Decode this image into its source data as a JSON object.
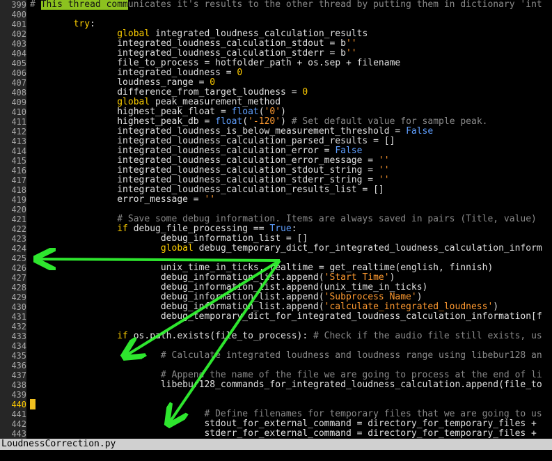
{
  "statusbar": {
    "filename": "LoudnessCorrection.py"
  },
  "cursor_line": 440,
  "lines": [
    {
      "n": "399",
      "s": [
        [
          "hl",
          "This thread comm"
        ],
        [
          "cm",
          "unicates it's results to the other thread by putting them in dictionary 'int"
        ]
      ],
      "p": "# "
    },
    {
      "n": "400",
      "s": []
    },
    {
      "n": "401",
      "s": [
        [
          "kw",
          "try"
        ],
        [
          "t",
          ":"
        ]
      ],
      "p": "        "
    },
    {
      "n": "402",
      "s": [
        [
          "kw",
          "global"
        ],
        [
          "t",
          " integrated_loudness_calculation_results"
        ]
      ],
      "p": "                "
    },
    {
      "n": "403",
      "s": [
        [
          "t",
          "integrated_loudness_calculation_stdout = b"
        ],
        [
          "st",
          "''"
        ]
      ],
      "p": "                "
    },
    {
      "n": "404",
      "s": [
        [
          "t",
          "integrated_loudness_calculation_stderr = b"
        ],
        [
          "st",
          "''"
        ]
      ],
      "p": "                "
    },
    {
      "n": "405",
      "s": [
        [
          "t",
          "file_to_process = hotfolder_path + os.sep + filename"
        ]
      ],
      "p": "                "
    },
    {
      "n": "406",
      "s": [
        [
          "t",
          "integrated_loudness = "
        ],
        [
          "num",
          "0"
        ]
      ],
      "p": "                "
    },
    {
      "n": "407",
      "s": [
        [
          "t",
          "loudness_range = "
        ],
        [
          "num",
          "0"
        ]
      ],
      "p": "                "
    },
    {
      "n": "408",
      "s": [
        [
          "t",
          "difference_from_target_loudness = "
        ],
        [
          "num",
          "0"
        ]
      ],
      "p": "                "
    },
    {
      "n": "409",
      "s": [
        [
          "kw",
          "global"
        ],
        [
          "t",
          " peak_measurement_method"
        ]
      ],
      "p": "                "
    },
    {
      "n": "410",
      "s": [
        [
          "t",
          "highest_peak_float = "
        ],
        [
          "bi",
          "float"
        ],
        [
          "t",
          "("
        ],
        [
          "st",
          "'0'"
        ],
        [
          "t",
          ")"
        ]
      ],
      "p": "                "
    },
    {
      "n": "411",
      "s": [
        [
          "t",
          "highest_peak_db = "
        ],
        [
          "bi",
          "float"
        ],
        [
          "t",
          "("
        ],
        [
          "st",
          "'-120'"
        ],
        [
          "t",
          ") "
        ],
        [
          "cm",
          "# Set default value for sample peak."
        ]
      ],
      "p": "                "
    },
    {
      "n": "412",
      "s": [
        [
          "t",
          "integrated_loudness_is_below_measurement_threshold = "
        ],
        [
          "bi",
          "False"
        ]
      ],
      "p": "                "
    },
    {
      "n": "413",
      "s": [
        [
          "t",
          "integrated_loudness_calculation_parsed_results = []"
        ]
      ],
      "p": "                "
    },
    {
      "n": "414",
      "s": [
        [
          "t",
          "integrated_loudness_calculation_error = "
        ],
        [
          "bi",
          "False"
        ]
      ],
      "p": "                "
    },
    {
      "n": "415",
      "s": [
        [
          "t",
          "integrated_loudness_calculation_error_message = "
        ],
        [
          "st",
          "''"
        ]
      ],
      "p": "                "
    },
    {
      "n": "416",
      "s": [
        [
          "t",
          "integrated_loudness_calculation_stdout_string = "
        ],
        [
          "st",
          "''"
        ]
      ],
      "p": "                "
    },
    {
      "n": "417",
      "s": [
        [
          "t",
          "integrated_loudness_calculation_stderr_string = "
        ],
        [
          "st",
          "''"
        ]
      ],
      "p": "                "
    },
    {
      "n": "418",
      "s": [
        [
          "t",
          "integrated_loudness_calculation_results_list = []"
        ]
      ],
      "p": "                "
    },
    {
      "n": "419",
      "s": [
        [
          "t",
          "error_message = "
        ],
        [
          "st",
          "''"
        ]
      ],
      "p": "                "
    },
    {
      "n": "420",
      "s": []
    },
    {
      "n": "421",
      "s": [
        [
          "cm",
          "# Save some debug information. Items are always saved in pairs (Title, value)"
        ]
      ],
      "p": "                "
    },
    {
      "n": "422",
      "s": [
        [
          "kw",
          "if"
        ],
        [
          "t",
          " debug_file_processing == "
        ],
        [
          "bi",
          "True"
        ],
        [
          "t",
          ":"
        ]
      ],
      "p": "                "
    },
    {
      "n": "423",
      "s": [
        [
          "t",
          "debug_information_list = []"
        ]
      ],
      "p": "                        "
    },
    {
      "n": "424",
      "s": [
        [
          "kw",
          "global"
        ],
        [
          "t",
          " debug_temporary_dict_for_integrated_loudness_calculation_inform"
        ]
      ],
      "p": "                        "
    },
    {
      "n": "425",
      "s": []
    },
    {
      "n": "426",
      "s": [
        [
          "t",
          "unix_time_in_ticks, realtime = get_realtime(english, finnish)"
        ]
      ],
      "p": "                        "
    },
    {
      "n": "427",
      "s": [
        [
          "t",
          "debug_information_list.append("
        ],
        [
          "st",
          "'Start Time'"
        ],
        [
          "t",
          ")"
        ]
      ],
      "p": "                        "
    },
    {
      "n": "428",
      "s": [
        [
          "t",
          "debug_information_list.append(unix_time_in_ticks)"
        ]
      ],
      "p": "                        "
    },
    {
      "n": "429",
      "s": [
        [
          "t",
          "debug_information_list.append("
        ],
        [
          "st",
          "'Subprocess Name'"
        ],
        [
          "t",
          ")"
        ]
      ],
      "p": "                        "
    },
    {
      "n": "430",
      "s": [
        [
          "t",
          "debug_information_list.append("
        ],
        [
          "st",
          "'calculate_integrated_loudness'"
        ],
        [
          "t",
          ")"
        ]
      ],
      "p": "                        "
    },
    {
      "n": "431",
      "s": [
        [
          "t",
          "debug_temporary_dict_for_integrated_loudness_calculation_information[f"
        ]
      ],
      "p": "                        "
    },
    {
      "n": "432",
      "s": []
    },
    {
      "n": "433",
      "s": [
        [
          "kw",
          "if"
        ],
        [
          "t",
          " os.path.exists(file_to_process): "
        ],
        [
          "cm",
          "# Check if the audio file still exists, us"
        ]
      ],
      "p": "                "
    },
    {
      "n": "434",
      "s": []
    },
    {
      "n": "435",
      "s": [
        [
          "cm",
          "# Calculate integrated loudness and loudness range using libebur128 an"
        ]
      ],
      "p": "                        "
    },
    {
      "n": "436",
      "s": []
    },
    {
      "n": "437",
      "s": [
        [
          "cm",
          "# Append the name of the file we are going to process at the end of li"
        ]
      ],
      "p": "                        "
    },
    {
      "n": "438",
      "s": [
        [
          "t",
          "libebur128_commands_for_integrated_loudness_calculation.append(file_to"
        ]
      ],
      "p": "                        "
    },
    {
      "n": "439",
      "s": []
    },
    {
      "n": "440",
      "s": []
    },
    {
      "n": "441",
      "s": [
        [
          "cm",
          "# Define filenames for temporary files that we are going to us"
        ]
      ],
      "p": "                                "
    },
    {
      "n": "442",
      "s": [
        [
          "t",
          "stdout_for_external_command = directory_for_temporary_files + "
        ]
      ],
      "p": "                                "
    },
    {
      "n": "443",
      "s": [
        [
          "t",
          "stderr_for_external_command = directory_for_temporary_files + "
        ]
      ],
      "p": "                                "
    }
  ]
}
